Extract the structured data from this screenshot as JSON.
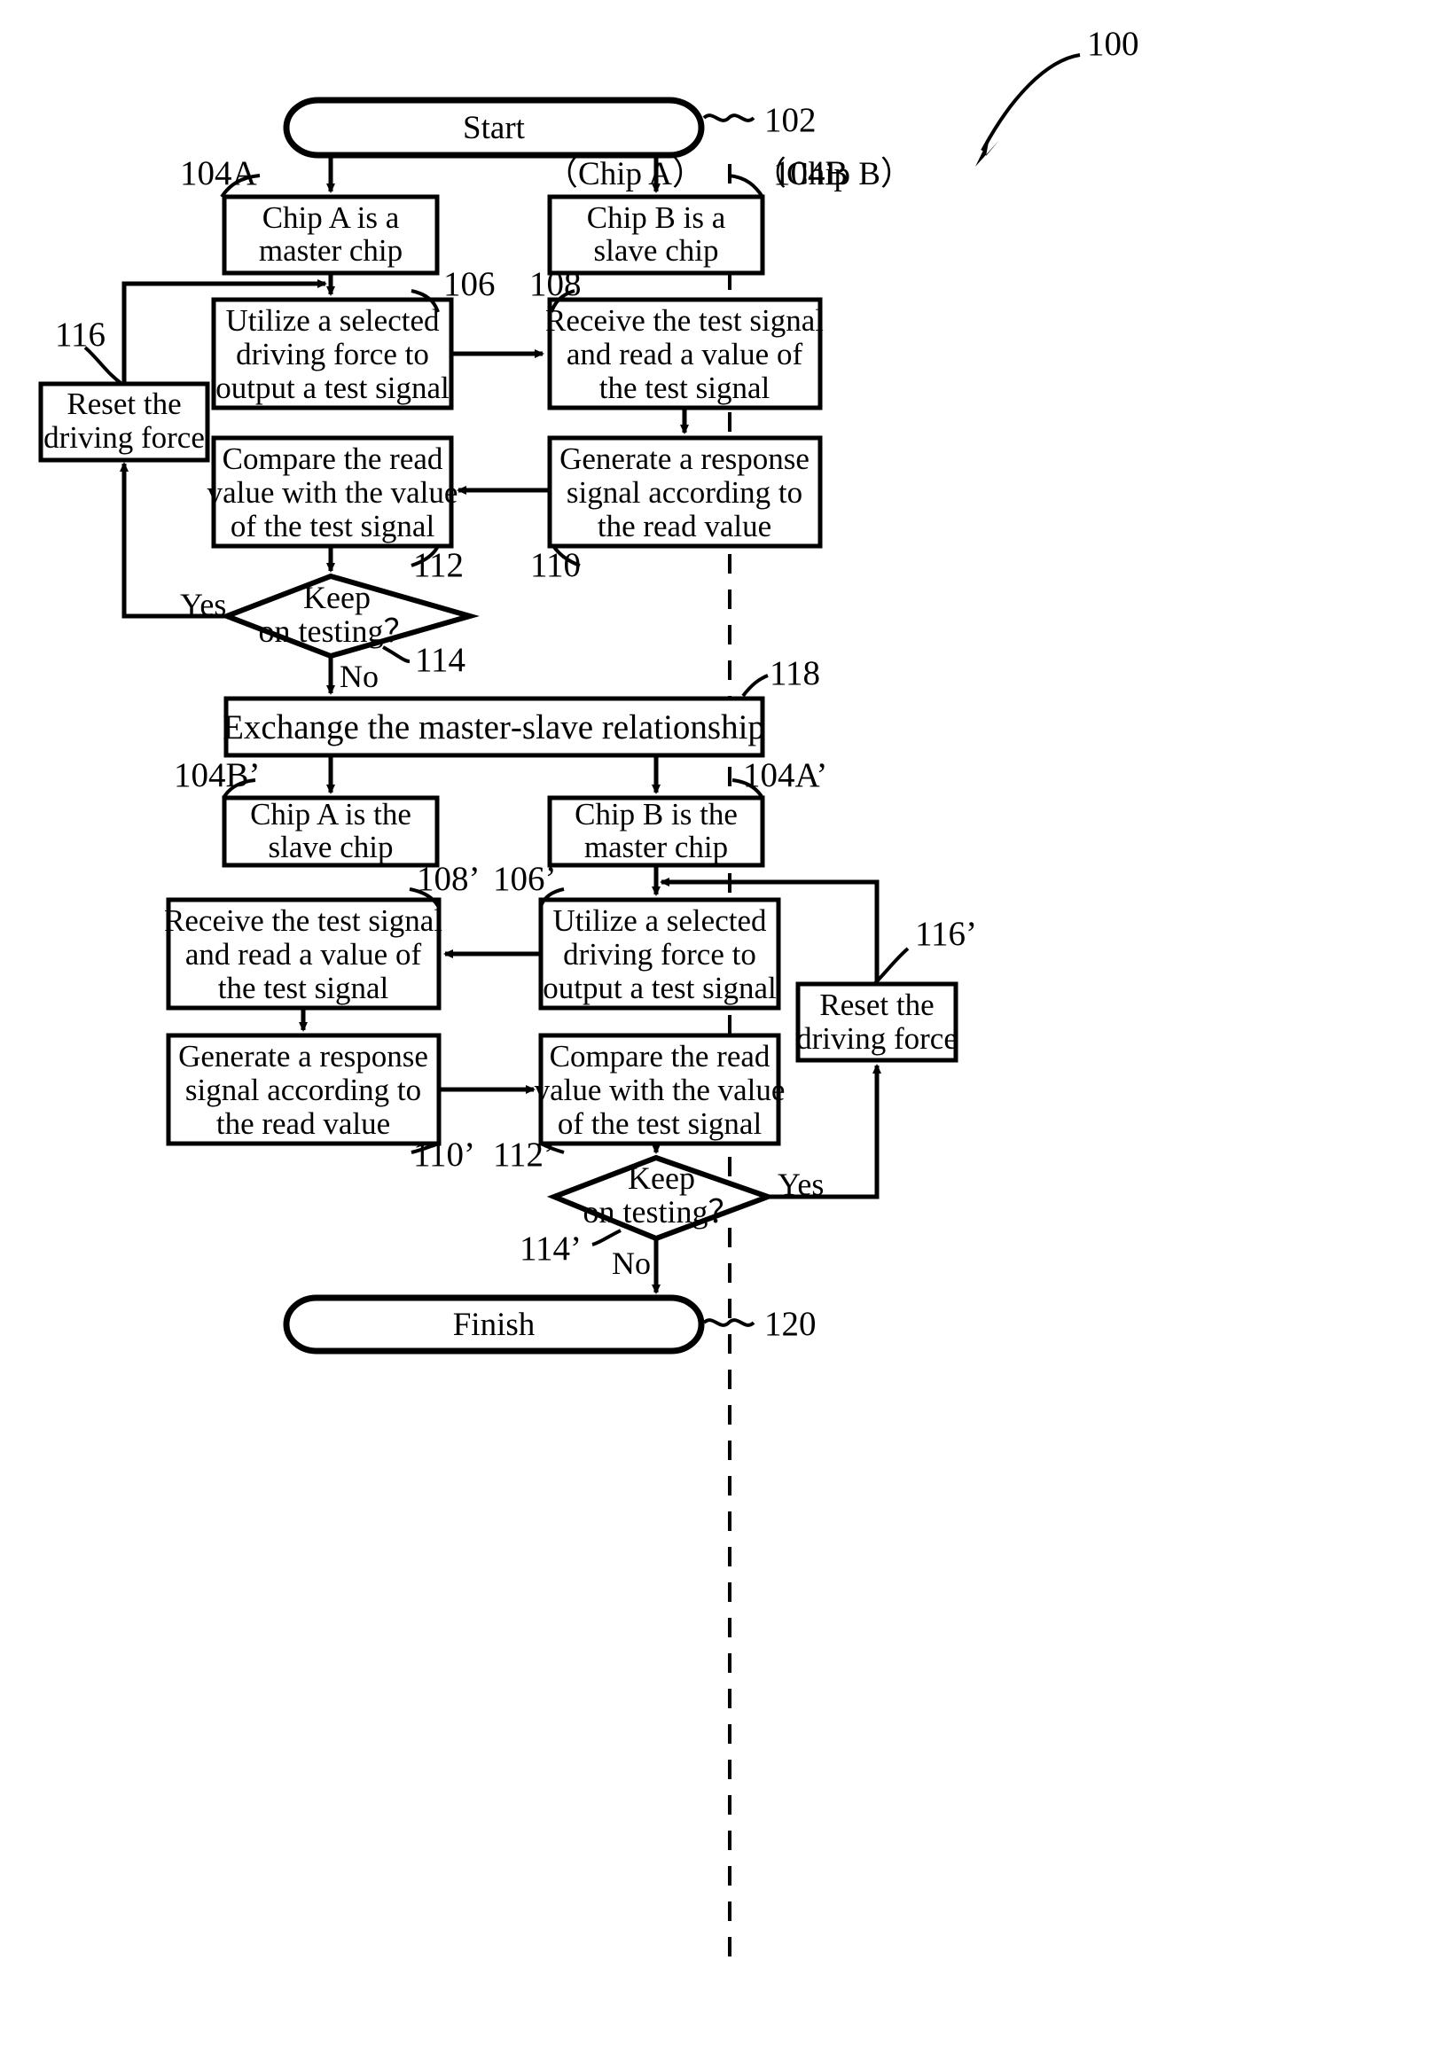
{
  "figure": {
    "ref_main": "100",
    "lane_left_label": "（Chip A）",
    "lane_right_label": "（Chip B）"
  },
  "nodes": {
    "start": {
      "label": "Start",
      "ref": "102"
    },
    "chip_a_master": {
      "line1": "Chip A is a",
      "line2": "master chip",
      "ref": "104A"
    },
    "chip_b_slave": {
      "line1": "Chip B is a",
      "line2": "slave chip",
      "ref": "104B"
    },
    "utilize_top": {
      "line1": "Utilize a selected",
      "line2": "driving force to",
      "line3": "output a test signal",
      "ref": "106"
    },
    "receive_top": {
      "line1": "Receive the test signal",
      "line2": "and read a value of",
      "line3": "the test signal",
      "ref": "108"
    },
    "compare_top": {
      "line1": "Compare the read",
      "line2": "value with the value",
      "line3": "of the test signal",
      "ref": "112"
    },
    "generate_top": {
      "line1": "Generate a response",
      "line2": "signal according to",
      "line3": "the read value",
      "ref": "110"
    },
    "reset_top": {
      "line1": "Reset the",
      "line2": "driving force",
      "ref": "116"
    },
    "decision_top": {
      "line1": "Keep",
      "line2": "on testing？",
      "ref": "114",
      "yes": "Yes",
      "no": "No"
    },
    "exchange": {
      "label": "Exchange the master‑slave relationship",
      "ref": "118"
    },
    "chip_a_slave": {
      "line1": "Chip A is the",
      "line2": "slave chip",
      "ref": "104B’"
    },
    "chip_b_master": {
      "line1": "Chip B is the",
      "line2": "master chip",
      "ref": "104A’"
    },
    "receive_bot": {
      "line1": "Receive the test signal",
      "line2": "and read a value of",
      "line3": "the test signal",
      "ref": "108’"
    },
    "utilize_bot": {
      "line1": "Utilize a selected",
      "line2": "driving force to",
      "line3": "output a test signal",
      "ref": "106’"
    },
    "generate_bot": {
      "line1": "Generate a response",
      "line2": "signal according to",
      "line3": "the read value",
      "ref": "110’"
    },
    "compare_bot": {
      "line1": "Compare the read",
      "line2": "value with the value",
      "line3": "of the test signal",
      "ref": "112’"
    },
    "reset_bot": {
      "line1": "Reset the",
      "line2": "driving force",
      "ref": "116’"
    },
    "decision_bot": {
      "line1": "Keep",
      "line2": "on testing？",
      "ref": "114’",
      "yes": "Yes",
      "no": "No"
    },
    "finish": {
      "label": "Finish",
      "ref": "120"
    }
  },
  "colors": {
    "ink": "#000000",
    "paper": "#ffffff"
  }
}
